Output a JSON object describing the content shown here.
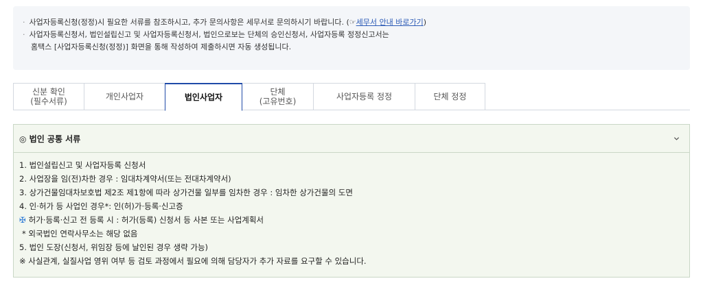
{
  "notice": {
    "line1_text": "사업자등록신청(정정)시 필요한 서류를 참조하시고, 추가 문의사항은 세무서로 문의하시기 바랍니다. (☞",
    "line1_link": "세무서 안내 바로가기",
    "line1_close": ")",
    "line2": "사업자등록신청서, 법인설립신고 및 사업자등록신청서, 법인으로보는 단체의 승인신청서, 사업자등록 정정신고서는",
    "line3": "홈택스 [사업자등록신청(정정)] 화면을 통해 작성하여 제출하시면 자동 생성됩니다."
  },
  "tabs": [
    {
      "line1": "신분 확인",
      "line2": "(필수서류)"
    },
    {
      "line1": "개인사업자",
      "line2": ""
    },
    {
      "line1": "법인사업자",
      "line2": ""
    },
    {
      "line1": "단체",
      "line2": "(고유번호)"
    },
    {
      "line1": "사업자등록 정정",
      "line2": ""
    },
    {
      "line1": "단체 정정",
      "line2": ""
    }
  ],
  "panel": {
    "title": "◎ 법인 공통 서류",
    "rows": [
      "1. 법인설립신고 및 사업자등록 신청서",
      "2. 사업장을 임(전)차한 경우 : 임대차계약서(또는 전대차계약서)",
      "3. 상가건물임대차보호법 제2조 제1항에 따라 상가건물 일부를 임차한 경우 : 임차한 상가건물의 도면",
      "4. 인·허가 등 사업인 경우*: 인(허)가·등록·신고증",
      "허가·등록·신고 전 등록 시 : 허가(등록) 신청서 등 사본 또는 사업계획서",
      " * 외국법인 연락사무소는 해당 없음",
      "5. 법인 도장(신청서, 위임장 등에 날인된 경우 생략 가능)",
      "※ 사실관계, 실질사업 영위 여부 등 검토 과정에서 필요에 의해 담당자가 추가 자료를 요구할 수 있습니다."
    ],
    "plus_symbol": "✠"
  }
}
